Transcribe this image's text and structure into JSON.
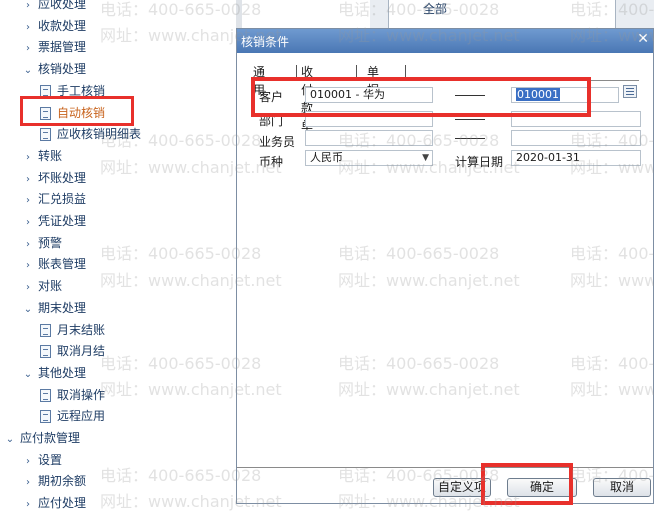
{
  "tree": {
    "items": [
      {
        "label": "应收处理",
        "arrow": "›",
        "kind": "group"
      },
      {
        "label": "收款处理",
        "arrow": "›",
        "kind": "group"
      },
      {
        "label": "票据管理",
        "arrow": "›",
        "kind": "group"
      },
      {
        "label": "核销处理",
        "arrow": "⌄",
        "kind": "group"
      },
      {
        "label": "手工核销",
        "kind": "leaf"
      },
      {
        "label": "自动核销",
        "kind": "leaf",
        "selected": true
      },
      {
        "label": "应收核销明细表",
        "kind": "leaf"
      },
      {
        "label": "转账",
        "arrow": "›",
        "kind": "group"
      },
      {
        "label": "坏账处理",
        "arrow": "›",
        "kind": "group"
      },
      {
        "label": "汇兑损益",
        "arrow": "›",
        "kind": "group"
      },
      {
        "label": "凭证处理",
        "arrow": "›",
        "kind": "group"
      },
      {
        "label": "预警",
        "arrow": "›",
        "kind": "group"
      },
      {
        "label": "账表管理",
        "arrow": "›",
        "kind": "group"
      },
      {
        "label": "对账",
        "arrow": "›",
        "kind": "group"
      },
      {
        "label": "期末处理",
        "arrow": "⌄",
        "kind": "group"
      },
      {
        "label": "月末结账",
        "kind": "leaf"
      },
      {
        "label": "取消月结",
        "kind": "leaf"
      },
      {
        "label": "其他处理",
        "arrow": "⌄",
        "kind": "group"
      },
      {
        "label": "取消操作",
        "kind": "leaf"
      },
      {
        "label": "远程应用",
        "kind": "leaf"
      },
      {
        "label": "应付款管理",
        "arrow": "⌄",
        "kind": "root"
      },
      {
        "label": "设置",
        "arrow": "›",
        "kind": "group"
      },
      {
        "label": "期初余额",
        "arrow": "›",
        "kind": "group"
      },
      {
        "label": "应付处理",
        "arrow": "›",
        "kind": "group"
      }
    ]
  },
  "background_window": {
    "item": "全部"
  },
  "dialog": {
    "title": "核销条件",
    "close_glyph": "✕",
    "tabs": [
      "通用",
      "收付款单",
      "单据"
    ],
    "customer": {
      "label": "客户",
      "from": "010001 - 华为",
      "to": "010001"
    },
    "department": {
      "label": "部门"
    },
    "salesperson": {
      "label": "业务员"
    },
    "currency": {
      "label": "币种",
      "value": "人民币"
    },
    "calc_date": {
      "label": "计算日期",
      "value": "2020-01-31"
    },
    "buttons": {
      "custom": "自定义项",
      "ok": "确定",
      "cancel": "取消"
    }
  },
  "watermark": {
    "phone": "电话：400-665-0028",
    "site": "网址：www.chanjet.net"
  },
  "colors": {
    "highlight": "#e8302b",
    "selected_tree_item": "#c8641e",
    "title_bar": "#4a77b4"
  }
}
